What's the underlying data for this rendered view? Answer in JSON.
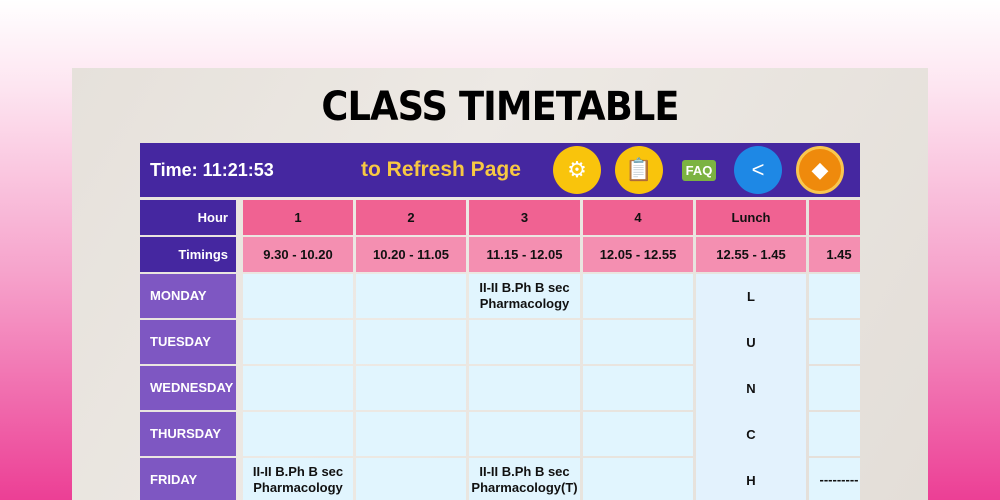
{
  "title": "CLASS TIMETABLE",
  "header": {
    "time": "Time: 11:21:53",
    "refresh": "to Refresh Page",
    "icons": [
      "settings-gears-icon",
      "notepad-icon",
      "faq-icon",
      "share-icon",
      "cards-icon"
    ]
  },
  "table": {
    "hour_label": "Hour",
    "timings_label": "Timings",
    "hours": [
      "1",
      "2",
      "3",
      "4",
      "Lunch",
      ""
    ],
    "timings": [
      "9.30 - 10.20",
      "10.20 - 11.05",
      "11.15 - 12.05",
      "12.05 - 12.55",
      "12.55 - 1.45",
      "1.45"
    ],
    "days": [
      {
        "name": "MONDAY",
        "cells": [
          "",
          "",
          "II-II B.Ph B sec Pharmacology",
          "",
          "L",
          ""
        ]
      },
      {
        "name": "TUESDAY",
        "cells": [
          "",
          "",
          "",
          "",
          "U",
          ""
        ]
      },
      {
        "name": "WEDNESDAY",
        "cells": [
          "",
          "",
          "",
          "",
          "N",
          ""
        ]
      },
      {
        "name": "THURSDAY",
        "cells": [
          "",
          "",
          "",
          "",
          "C",
          ""
        ]
      },
      {
        "name": "FRIDAY",
        "cells": [
          "II-II B.Ph B sec Pharmacology",
          "",
          "II-II B.Ph B sec Pharmacology(T)",
          "",
          "H",
          "---------"
        ]
      }
    ]
  }
}
